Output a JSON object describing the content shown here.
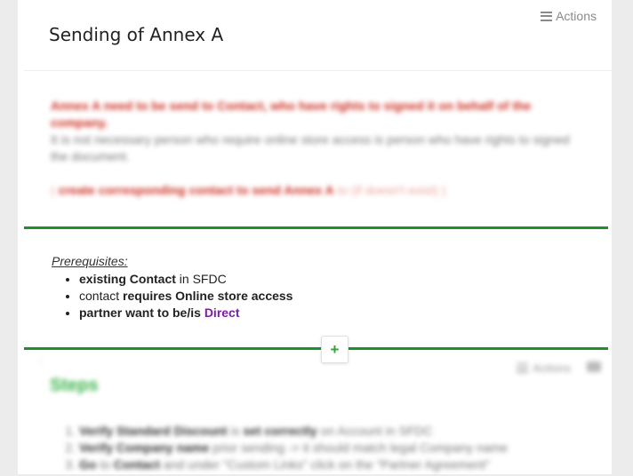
{
  "header": {
    "title": "Sending of Annex A",
    "actions_label": "Actions"
  },
  "note": {
    "line1": "Annex A need to be send to Contact, who have rights to signed it on behalf of the company.",
    "line2": "It is not necessary person who require online store access is person who have rights to signed the document.",
    "link_prefix": "( ",
    "link_bold": "create corresponding contact to send Annex A",
    "link_rest": " to (if doesn't exist) )"
  },
  "prerequisites": {
    "title": "Prerequisites:",
    "items": [
      {
        "bold": "existing Contact",
        "rest": " in SFDC"
      },
      {
        "pre": "contact ",
        "bold": "requires Online store access"
      },
      {
        "bold": "partner want to be/is ",
        "highlight": "Direct"
      }
    ]
  },
  "add_button": {
    "label": "+"
  },
  "steps": {
    "title": "Steps",
    "actions_label": "Actions",
    "items": [
      {
        "bold": "Verify Standard Discount",
        "mid": " is ",
        "bold2": "set correctly",
        "rest": " on Account in SFDC"
      },
      {
        "bold": "Verify Company name",
        "rest": " prior sending -> it should match legal Company name"
      },
      {
        "bold": "Go",
        "mid": " to ",
        "bold2": "Contact",
        "rest": " and under \"Custom Links\" click on the \"Partner Agreement\""
      }
    ]
  },
  "colors": {
    "divider_green": "#1f8f2b",
    "note_red": "#cc2a1e",
    "direct_purple": "#7a1fa2",
    "steps_green": "#3bb44a"
  }
}
